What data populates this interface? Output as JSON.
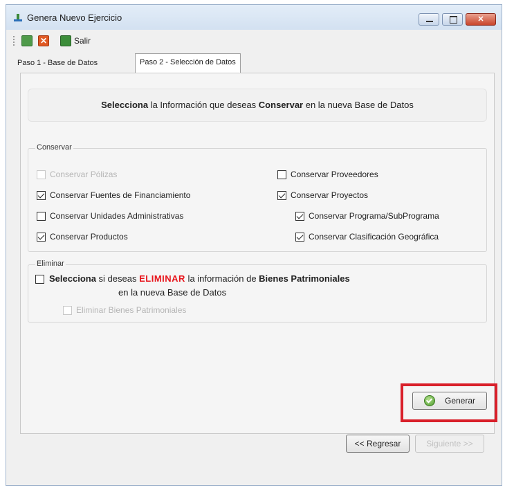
{
  "window": {
    "title": "Genera Nuevo Ejercicio"
  },
  "toolbar": {
    "salir_label": "Salir"
  },
  "tabs": [
    {
      "label": "Paso 1 - Base de Datos"
    },
    {
      "label": "Paso 2 - Selección de Datos"
    }
  ],
  "banner": {
    "bold1": "Selecciona",
    "text1": " la Información que deseas ",
    "bold2": "Conservar",
    "text2": " en la nueva Base de Datos"
  },
  "conservar": {
    "legend": "Conservar",
    "items": [
      {
        "label": "Conservar Pólizas",
        "checked": false,
        "enabled": false
      },
      {
        "label": "Conservar Fuentes de Financiamiento",
        "checked": true,
        "enabled": true
      },
      {
        "label": "Conservar Unidades Administrativas",
        "checked": false,
        "enabled": true
      },
      {
        "label": "Conservar Productos",
        "checked": true,
        "enabled": true
      },
      {
        "label": "Conservar Proveedores",
        "checked": false,
        "enabled": true
      },
      {
        "label": "Conservar Proyectos",
        "checked": true,
        "enabled": true
      },
      {
        "label": "Conservar Programa/SubPrograma",
        "checked": true,
        "enabled": true
      },
      {
        "label": "Conservar Clasificación Geográfica",
        "checked": true,
        "enabled": true
      }
    ]
  },
  "eliminar": {
    "legend": "Eliminar",
    "bold1": "Selecciona",
    "text1": " si deseas ",
    "red": "ELIMINAR",
    "text2": " la información de ",
    "bold2": "Bienes Patrimoniales",
    "line2": "en la nueva Base de Datos",
    "sub_label": "Eliminar Bienes Patrimoniales"
  },
  "buttons": {
    "generar": "Generar",
    "regresar": "<< Regresar",
    "siguiente": "Siguiente >>"
  }
}
